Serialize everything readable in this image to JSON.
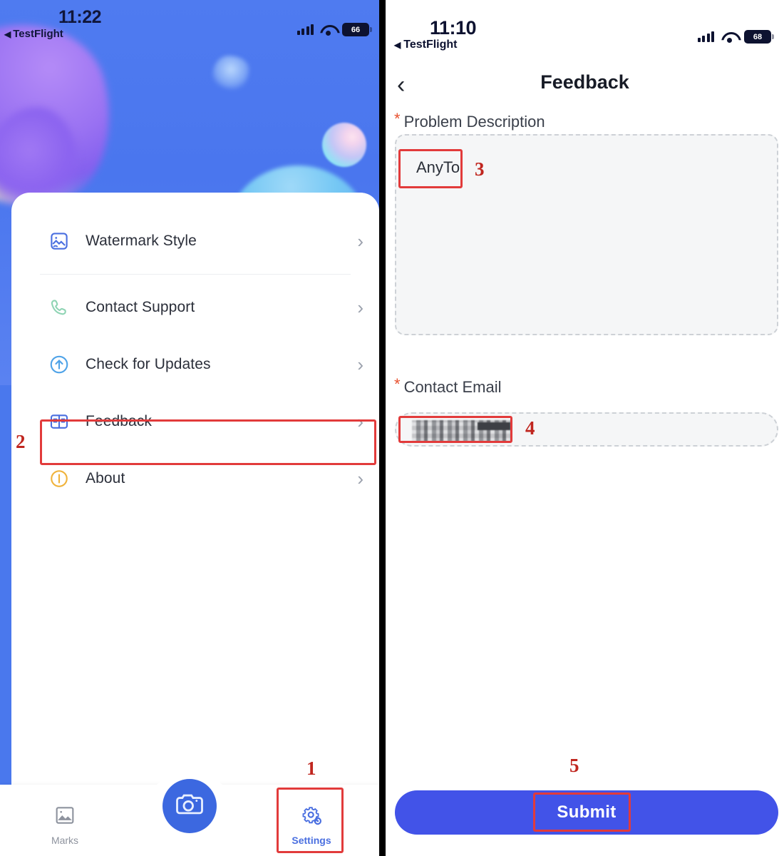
{
  "left_phone": {
    "status_bar": {
      "time": "11:22",
      "return_app": "TestFlight",
      "return_arrow": "◀",
      "battery": "66",
      "signal_icon": "cellular-signal-icon",
      "wifi_icon": "wifi-icon",
      "battery_icon": "battery-icon"
    },
    "menu": {
      "items": [
        {
          "label": "Watermark Style",
          "icon": "image-watermark-icon",
          "chevron": "›"
        },
        {
          "label": "Contact Support",
          "icon": "phone-handset-icon",
          "chevron": "›"
        },
        {
          "label": "Check for Updates",
          "icon": "arrow-up-circle-icon",
          "chevron": "›"
        },
        {
          "label": "Feedback",
          "icon": "panels-icon",
          "chevron": "›"
        },
        {
          "label": "About",
          "icon": "info-circle-icon",
          "chevron": "›"
        }
      ]
    },
    "tabbar": {
      "marks_label": "Marks",
      "marks_icon": "photo-gallery-icon",
      "camera_icon": "camera-icon",
      "settings_label": "Settings",
      "settings_icon": "gear-icon"
    },
    "annotations": [
      {
        "number": "1",
        "target": "settings-tab"
      },
      {
        "number": "2",
        "target": "feedback-menu-row"
      }
    ]
  },
  "right_phone": {
    "status_bar": {
      "time": "11:10",
      "return_app": "TestFlight",
      "return_arrow": "◀",
      "battery": "68"
    },
    "navbar": {
      "back_icon": "‹",
      "title": "Feedback"
    },
    "form": {
      "problem_description": {
        "label": "Problem Description",
        "required_marker": "*",
        "value": "AnyTo"
      },
      "contact_email": {
        "label": "Contact Email",
        "required_marker": "*",
        "value": ""
      },
      "submit_label": "Submit"
    },
    "annotations": [
      {
        "number": "3",
        "target": "problem-description-value"
      },
      {
        "number": "4",
        "target": "contact-email-value"
      },
      {
        "number": "5",
        "target": "submit-button"
      }
    ]
  },
  "colors": {
    "wallpaper_blue": "#4a78ed",
    "accent_blue": "#4253e8",
    "camera_blue": "#3c68e0",
    "highlight_red": "#e23b3b",
    "annotation_red": "#c0261f",
    "required_orange": "#e8512f"
  }
}
